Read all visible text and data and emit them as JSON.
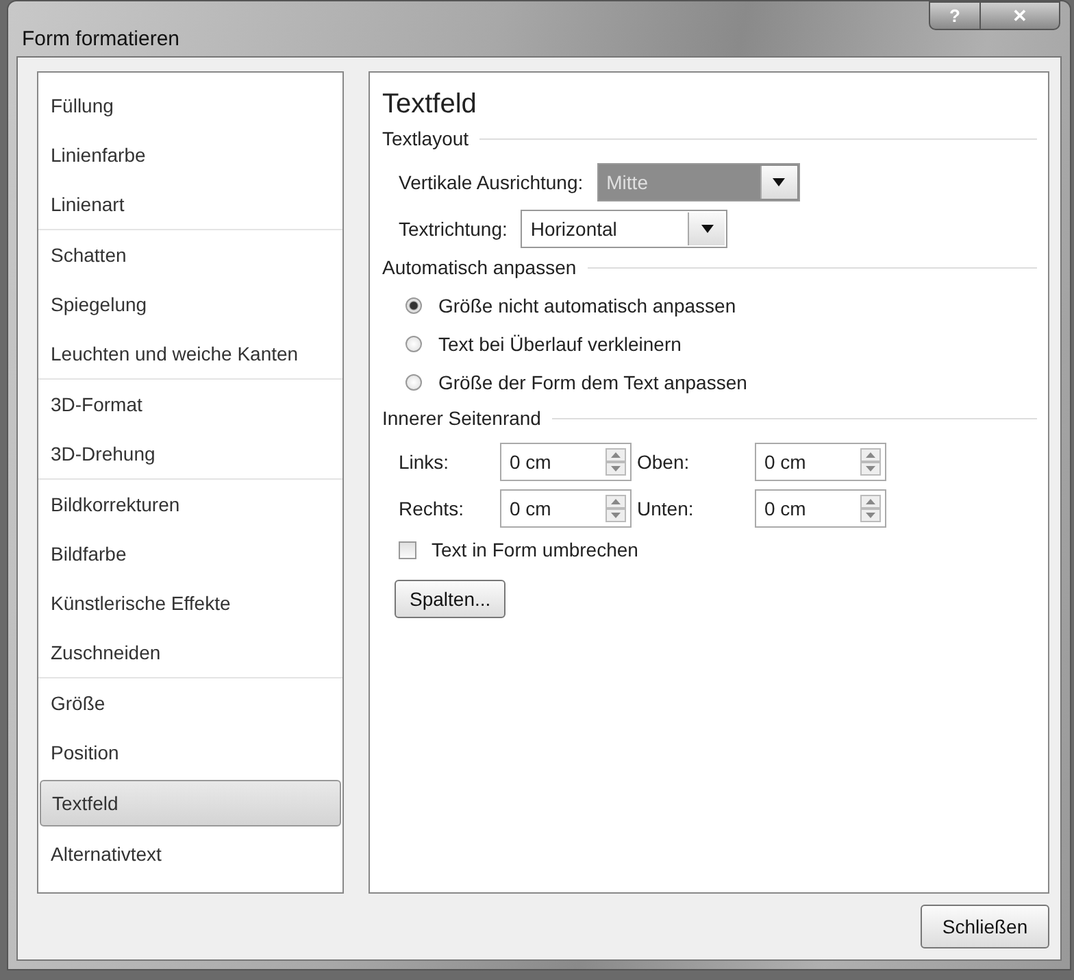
{
  "window": {
    "title": "Form formatieren",
    "help_button": "?",
    "close_button": "✕"
  },
  "sidebar": {
    "groups": [
      {
        "items": [
          {
            "label": "Füllung",
            "selected": false
          },
          {
            "label": "Linienfarbe",
            "selected": false
          },
          {
            "label": "Linienart",
            "selected": false
          }
        ]
      },
      {
        "items": [
          {
            "label": "Schatten",
            "selected": false
          },
          {
            "label": "Spiegelung",
            "selected": false
          },
          {
            "label": "Leuchten und weiche Kanten",
            "selected": false
          }
        ]
      },
      {
        "items": [
          {
            "label": "3D-Format",
            "selected": false
          },
          {
            "label": "3D-Drehung",
            "selected": false
          }
        ]
      },
      {
        "items": [
          {
            "label": "Bildkorrekturen",
            "selected": false
          },
          {
            "label": "Bildfarbe",
            "selected": false
          },
          {
            "label": "Künstlerische Effekte",
            "selected": false
          },
          {
            "label": "Zuschneiden",
            "selected": false
          }
        ]
      },
      {
        "items": [
          {
            "label": "Größe",
            "selected": false
          },
          {
            "label": "Position",
            "selected": false
          },
          {
            "label": "Textfeld",
            "selected": true
          },
          {
            "label": "Alternativtext",
            "selected": false
          }
        ]
      }
    ]
  },
  "panel": {
    "title": "Textfeld",
    "text_layout": {
      "heading": "Textlayout",
      "dropdowns": [
        {
          "label": "Vertikale Ausrichtung:",
          "value": "Mitte",
          "disabled": true
        },
        {
          "label": "Textrichtung:",
          "value": "Horizontal",
          "disabled": false
        }
      ]
    },
    "autofit": {
      "heading": "Automatisch anpassen",
      "options": [
        {
          "label": "Größe nicht automatisch anpassen",
          "selected": true
        },
        {
          "label": "Text bei Überlauf verkleinern",
          "selected": false
        },
        {
          "label": "Größe der Form dem Text anpassen",
          "selected": false
        }
      ]
    },
    "margins": {
      "heading": "Innerer Seitenrand",
      "fields": [
        {
          "label": "Links:",
          "value": "0 cm"
        },
        {
          "label": "Oben:",
          "value": "0 cm"
        },
        {
          "label": "Rechts:",
          "value": "0 cm"
        },
        {
          "label": "Unten:",
          "value": "0 cm"
        }
      ],
      "wrap": {
        "label": "Text in Form umbrechen",
        "checked": false
      }
    },
    "columns_button": "Spalten..."
  },
  "buttons": [
    "Schließen"
  ]
}
